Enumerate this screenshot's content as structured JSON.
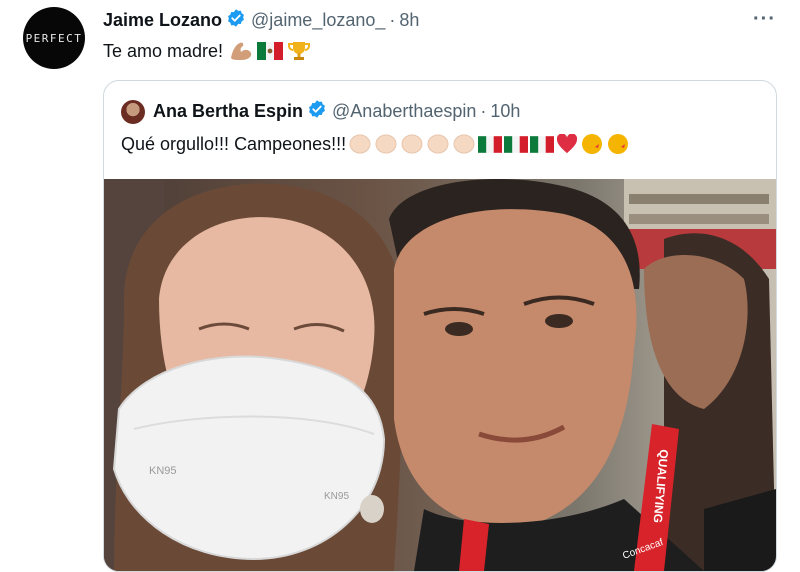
{
  "tweet": {
    "author_name": "Jaime Lozano",
    "handle": "@jaime_lozano_",
    "separator": "·",
    "time": "8h",
    "text": "Te amo madre!",
    "more_label": "···",
    "avatar_text": "PERFECT"
  },
  "quoted": {
    "author_name": "Ana Bertha Espin",
    "handle": "@Anaberthaespin",
    "separator": "·",
    "time": "10h",
    "text": "Qué orgullo!!! Campeones!!!"
  },
  "photo": {
    "mask_text_left": "KN95",
    "mask_text_right": "KN95",
    "lanyard_text": "QUALIFYING",
    "lanyard_sponsor": "Concacaf"
  },
  "colors": {
    "text": "#0f1419",
    "muted": "#536471",
    "verified": "#1d9bf0",
    "border": "#cfd9de"
  },
  "icons": {
    "verified": "verified-badge",
    "more": "more-icon",
    "emoji": [
      "flexed-biceps",
      "mexico-flag",
      "trophy",
      "clapping-hands",
      "red-heart",
      "kissing-face"
    ]
  }
}
